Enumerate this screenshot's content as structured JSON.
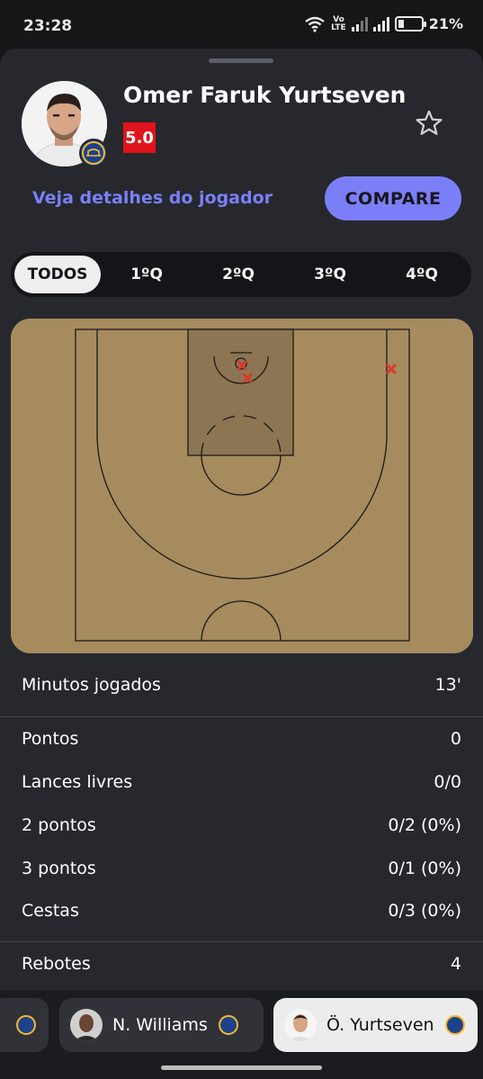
{
  "status_bar": {
    "time": "23:28",
    "volte_top": "Vo",
    "volte_bottom": "LTE",
    "battery": "21%"
  },
  "player": {
    "name": "Omer Faruk Yurtseven",
    "rating": "5.0",
    "rating_color": "#e0141a",
    "team_icon": "golden-state-warriors-logo"
  },
  "actions": {
    "details_link": "Veja detalhes do jogador",
    "compare_label": "COMPARE",
    "accent": "#7b7ff7"
  },
  "tabs": [
    {
      "label": "TODOS",
      "active": true
    },
    {
      "label": "1ºQ",
      "active": false
    },
    {
      "label": "2ºQ",
      "active": false
    },
    {
      "label": "3ºQ",
      "active": false
    },
    {
      "label": "4ºQ",
      "active": false
    }
  ],
  "shot_chart": {
    "court_color": "#a68b5e",
    "paint_color": "#8c7552",
    "miss_marker": "red-x",
    "missed_shots": 3
  },
  "stats": {
    "minutes": {
      "label": "Minutos jogados",
      "value": "13'"
    },
    "points": {
      "label": "Pontos",
      "value": "0"
    },
    "free_throws": {
      "label": "Lances livres",
      "value": "0/0"
    },
    "two_pt": {
      "label": "2 pontos",
      "value": "0/2 (0%)"
    },
    "three_pt": {
      "label": "3 pontos",
      "value": "0/1 (0%)"
    },
    "field_goals": {
      "label": "Cestas",
      "value": "0/3 (0%)"
    },
    "rebounds": {
      "label": "Rebotes",
      "value": "4"
    }
  },
  "bottom_players": [
    {
      "name": "N. Williams",
      "selected": false
    },
    {
      "name": "Ö. Yurtseven",
      "selected": true
    }
  ]
}
